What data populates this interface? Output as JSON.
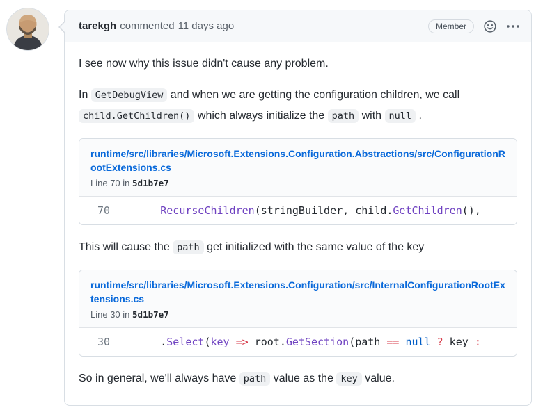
{
  "colors": {
    "header_bg": "#f6f8fa",
    "border": "#d8dee4",
    "text_primary": "#24292f",
    "text_muted": "#586069",
    "link_blue": "#0969da",
    "inline_code_bg": "#eff1f3",
    "syntax_purple": "#6f42c1",
    "syntax_red": "#d73a49",
    "syntax_blue": "#005cc5",
    "line_number_gray": "#6e7781"
  },
  "header": {
    "author": "tarekgh",
    "action": "commented",
    "timestamp": "11 days ago",
    "badge": "Member"
  },
  "paragraphs": {
    "p1": "I see now why this issue didn't cause any problem.",
    "p2": {
      "t1": "In ",
      "c1": "GetDebugView",
      "t2": " and when we are getting the configuration children, we call ",
      "c2": "child.GetChildren()",
      "t3": " which always initialize the ",
      "c3": "path",
      "t4": " with ",
      "c4": "null",
      "t5": " ."
    },
    "p3": {
      "t1": "This will cause the ",
      "c1": "path",
      "t2": " get initialized with the same value of the key"
    },
    "p4": {
      "t1": "So in general, we'll always have ",
      "c1": "path",
      "t2": " value as the ",
      "c2": "key",
      "t3": " value."
    }
  },
  "snippets": [
    {
      "file": "runtime/src/libraries/Microsoft.Extensions.Configuration.Abstractions/src/ConfigurationRootExtensions.cs",
      "line_label": "Line 70 in",
      "commit": "5d1b7e7",
      "line_number": "70",
      "tokens": [
        {
          "t": "        ",
          "c": "plain"
        },
        {
          "t": "RecurseChildren",
          "c": "purple"
        },
        {
          "t": "(stringBuilder, child.",
          "c": "plain"
        },
        {
          "t": "GetChildren",
          "c": "purple"
        },
        {
          "t": "(),",
          "c": "plain"
        }
      ]
    },
    {
      "file": "runtime/src/libraries/Microsoft.Extensions.Configuration/src/InternalConfigurationRootExtensions.cs",
      "line_label": "Line 30 in",
      "commit": "5d1b7e7",
      "line_number": "30",
      "tokens": [
        {
          "t": "        .",
          "c": "plain"
        },
        {
          "t": "Select",
          "c": "purple"
        },
        {
          "t": "(",
          "c": "plain"
        },
        {
          "t": "key",
          "c": "purple"
        },
        {
          "t": " ",
          "c": "plain"
        },
        {
          "t": "=>",
          "c": "red"
        },
        {
          "t": " root.",
          "c": "plain"
        },
        {
          "t": "GetSection",
          "c": "purple"
        },
        {
          "t": "(path ",
          "c": "plain"
        },
        {
          "t": "==",
          "c": "red"
        },
        {
          "t": " ",
          "c": "plain"
        },
        {
          "t": "null",
          "c": "blue"
        },
        {
          "t": " ",
          "c": "plain"
        },
        {
          "t": "?",
          "c": "red"
        },
        {
          "t": " key ",
          "c": "plain"
        },
        {
          "t": ":",
          "c": "red"
        }
      ]
    }
  ]
}
